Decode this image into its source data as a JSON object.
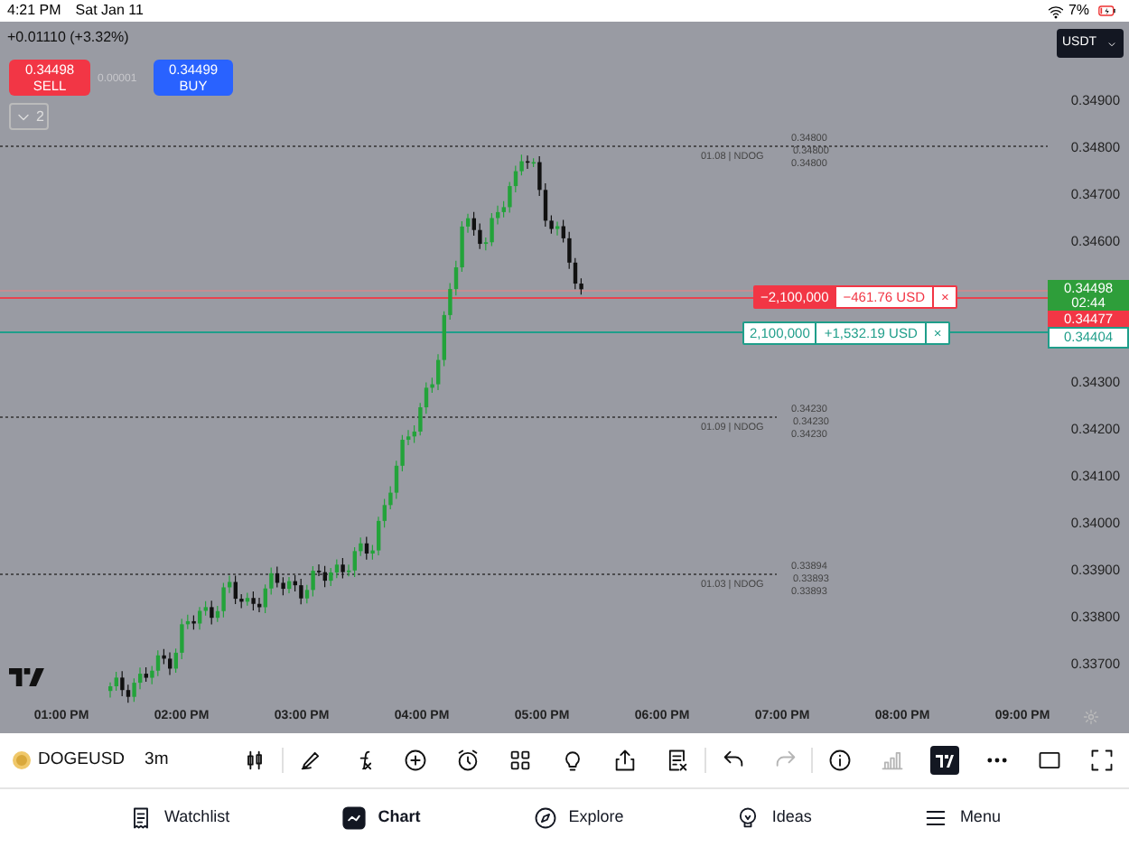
{
  "status_bar": {
    "time": "4:21 PM",
    "date": "Sat Jan 11",
    "battery": "7%"
  },
  "header": {
    "change": "+0.01110 (+3.32%)",
    "sell": {
      "price": "0.34498",
      "label": "SELL"
    },
    "spread": "0.00001",
    "buy": {
      "price": "0.34499",
      "label": "BUY"
    },
    "collapse_count": "2",
    "currency": "USDT"
  },
  "price_axis": [
    "0.34900",
    "0.34800",
    "0.34700",
    "0.34600",
    "0.34300",
    "0.34200",
    "0.34100",
    "0.34000",
    "0.33900",
    "0.33800",
    "0.33700"
  ],
  "price_markers": [
    {
      "kind": "current",
      "price": "0.34498",
      "countdown": "02:44"
    },
    {
      "kind": "sell",
      "price": "0.34477"
    },
    {
      "kind": "buy",
      "price": "0.34404"
    }
  ],
  "positions": [
    {
      "kind": "sell",
      "quantity": "−2,100,000",
      "pnl": "−461.76 USD",
      "close": "×"
    },
    {
      "kind": "buy",
      "quantity": "2,100,000",
      "pnl": "+1,532.19 USD",
      "close": "×"
    }
  ],
  "levels": [
    {
      "label": "01.08 | NDOG",
      "prices": [
        "0.34800",
        "0.34800",
        "0.34800"
      ]
    },
    {
      "label": "01.09 | NDOG",
      "prices": [
        "0.34230",
        "0.34230",
        "0.34230"
      ]
    },
    {
      "label": "01.03 | NDOG",
      "prices": [
        "0.33894",
        "0.33893",
        "0.33893"
      ]
    }
  ],
  "time_axis": [
    "01:00 PM",
    "02:00 PM",
    "03:00 PM",
    "04:00 PM",
    "05:00 PM",
    "06:00 PM",
    "07:00 PM",
    "08:00 PM",
    "09:00 PM"
  ],
  "toolbar": {
    "symbol": "DOGEUSD",
    "interval": "3m",
    "tools": [
      {
        "kind": "candles",
        "disabled": false
      },
      {
        "kind": "draw",
        "disabled": false
      },
      {
        "kind": "indicators",
        "disabled": false
      },
      {
        "kind": "add",
        "disabled": false
      },
      {
        "kind": "alert",
        "disabled": false
      },
      {
        "kind": "layout",
        "disabled": false
      },
      {
        "kind": "ideas",
        "disabled": false
      },
      {
        "kind": "share",
        "disabled": false
      },
      {
        "kind": "notes",
        "disabled": false
      },
      {
        "kind": "undo",
        "disabled": false
      },
      {
        "kind": "redo",
        "disabled": true
      },
      {
        "kind": "info",
        "disabled": false
      },
      {
        "kind": "bars",
        "disabled": true
      },
      {
        "kind": "logo",
        "disabled": false
      },
      {
        "kind": "more",
        "disabled": false
      },
      {
        "kind": "window",
        "disabled": false
      },
      {
        "kind": "fullscreen",
        "disabled": false
      }
    ]
  },
  "nav": [
    {
      "label": "Watchlist",
      "kind": "watchlist",
      "selected": false
    },
    {
      "label": "Chart",
      "kind": "chart",
      "selected": true
    },
    {
      "label": "Explore",
      "kind": "explore",
      "selected": false
    },
    {
      "label": "Ideas",
      "kind": "ideas",
      "selected": false
    },
    {
      "label": "Menu",
      "kind": "menu",
      "selected": false
    }
  ]
}
